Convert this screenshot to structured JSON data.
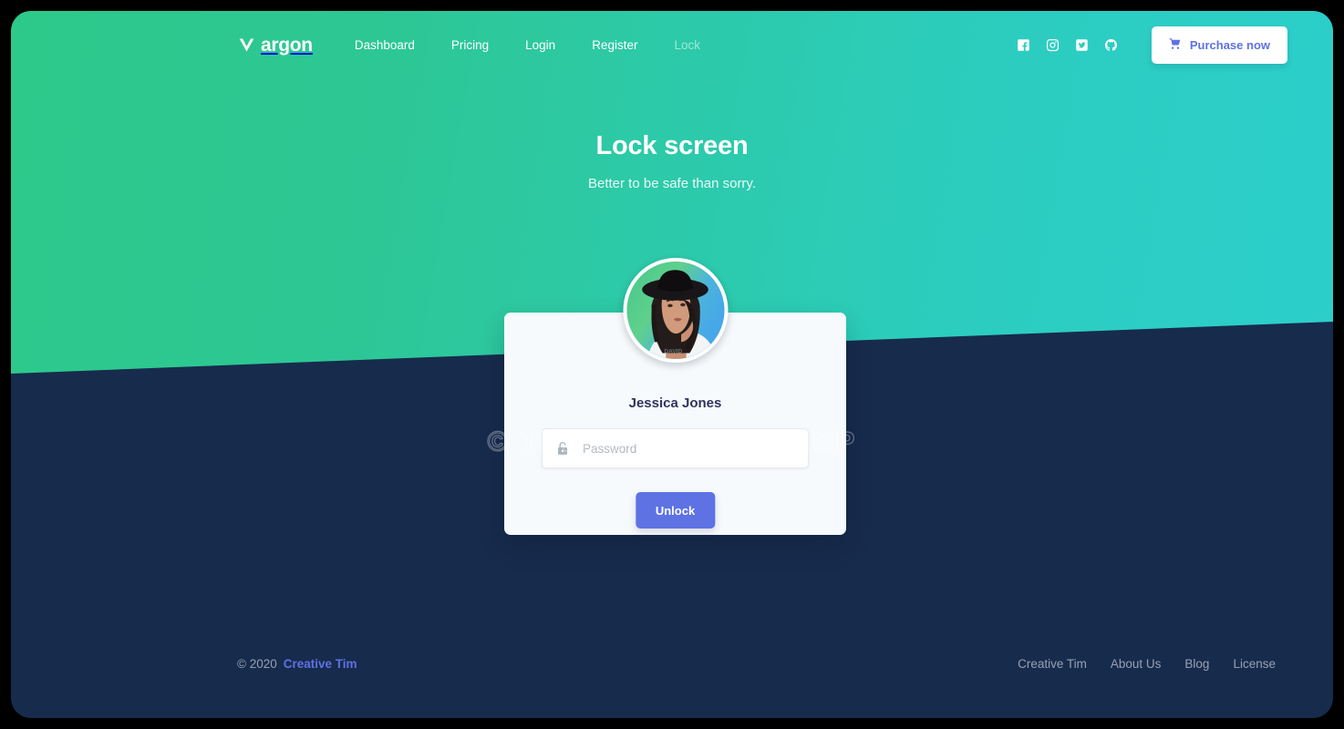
{
  "navbar": {
    "brand": "argon",
    "brand_icon": "argon-v-logo",
    "links": [
      {
        "label": "Dashboard",
        "active": false
      },
      {
        "label": "Pricing",
        "active": false
      },
      {
        "label": "Login",
        "active": false
      },
      {
        "label": "Register",
        "active": false
      },
      {
        "label": "Lock",
        "active": true
      }
    ],
    "social": [
      {
        "name": "facebook-icon"
      },
      {
        "name": "instagram-icon"
      },
      {
        "name": "twitter-icon"
      },
      {
        "name": "github-icon"
      }
    ],
    "purchase_label": "Purchase now",
    "purchase_icon": "shopping-cart-icon"
  },
  "hero": {
    "title": "Lock screen",
    "subtitle": "Better to be safe than sorry."
  },
  "card": {
    "avatar_alt": "Jessica Jones profile photo",
    "name": "Jessica Jones",
    "password_placeholder": "Password",
    "password_value": "",
    "password_icon": "unlock-icon",
    "unlock_label": "Unlock"
  },
  "watermark": "© THESOFTWARE.SHOP",
  "footer": {
    "copyright": "© 2020",
    "copyright_link": "Creative Tim",
    "links": [
      {
        "label": "Creative Tim"
      },
      {
        "label": "About Us"
      },
      {
        "label": "Blog"
      },
      {
        "label": "License"
      }
    ]
  },
  "colors": {
    "hero_gradient_start": "#2dc98a",
    "hero_gradient_end": "#2ccecb",
    "page_dark": "#172b4d",
    "accent_primary": "#5e72e4",
    "card_bg": "#f7fafc",
    "heading": "#32325d"
  }
}
